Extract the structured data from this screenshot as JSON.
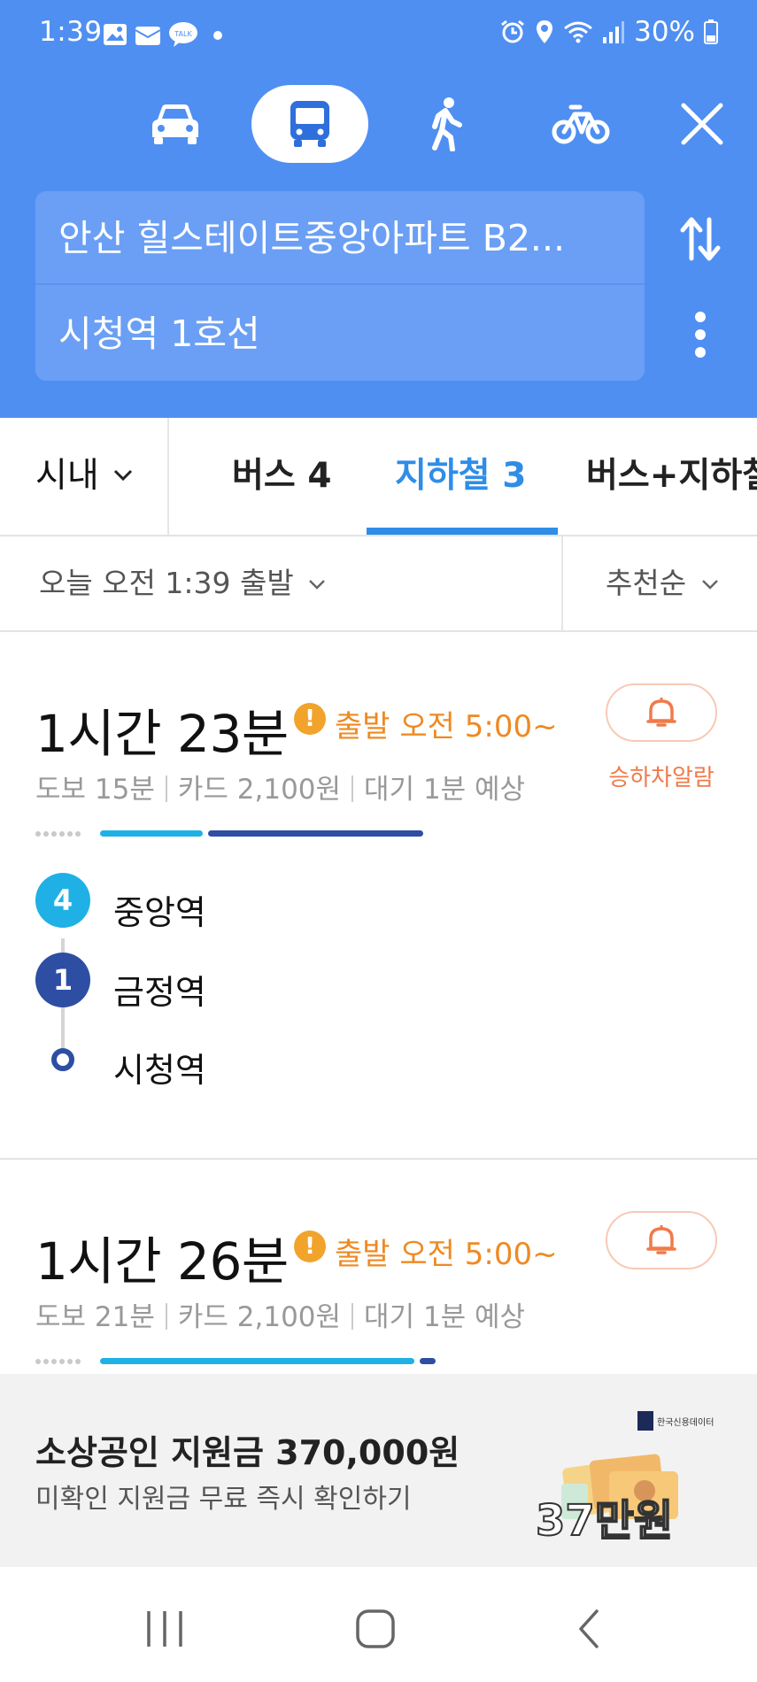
{
  "status_bar": {
    "time": "1:39",
    "battery": "30%"
  },
  "modes": [
    {
      "name": "car-icon",
      "active": false
    },
    {
      "name": "bus-icon",
      "active": true
    },
    {
      "name": "walk-icon",
      "active": false
    },
    {
      "name": "bicycle-icon",
      "active": false
    }
  ],
  "route": {
    "origin": "안산 힐스테이트중앙아파트 B2...",
    "destination": "시청역 1호선"
  },
  "tabs": {
    "region": "시내",
    "items": [
      {
        "label": "버스 4"
      },
      {
        "label": "지하철 3",
        "active": true
      },
      {
        "label": "버스+지하철"
      }
    ]
  },
  "filters": {
    "departure": "오늘 오전 1:39 출발",
    "sort": "추천순"
  },
  "results": [
    {
      "duration": "1시간 23분",
      "warning": "출발 오전 5:00~",
      "walk": "도보 15분",
      "fare": "카드 2,100원",
      "wait": "대기 1분 예상",
      "alarm_label": "승하차알람",
      "stops": [
        {
          "badge": "4",
          "name": "중앙역",
          "color": "#1fb1e6"
        },
        {
          "badge": "1",
          "name": "금정역",
          "color": "#2d4ea3"
        },
        {
          "badge": "",
          "name": "시청역",
          "color": "#2d4ea3"
        }
      ]
    },
    {
      "duration": "1시간 26분",
      "warning": "출발 오전 5:00~",
      "walk": "도보 21분",
      "fare": "카드 2,100원",
      "wait": "대기 1분 예상"
    }
  ],
  "ad": {
    "title": "소상공인 지원금 370,000원",
    "subtitle": "미확인 지원금 무료 즉시 확인하기",
    "brand": "한국신용데이터",
    "badge": "37만원"
  },
  "colors": {
    "header": "#4f8ff2",
    "accent": "#2f8de8",
    "line4": "#1fb1e6",
    "line1": "#2d4ea3",
    "warning": "#ee8a22"
  }
}
